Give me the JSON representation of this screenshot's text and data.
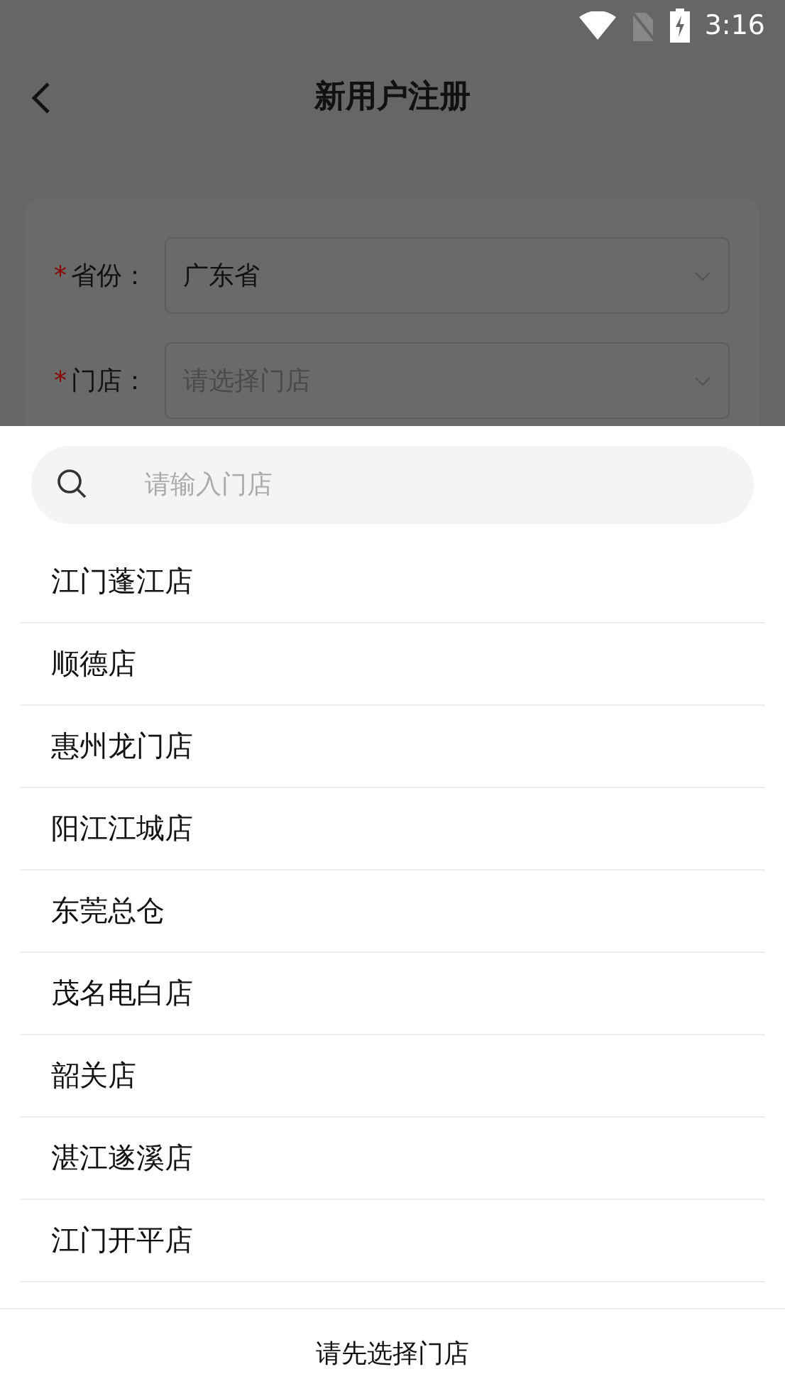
{
  "status_bar": {
    "time": "3:16"
  },
  "header": {
    "title": "新用户注册"
  },
  "form": {
    "fields": [
      {
        "mark": "*",
        "label": "省份：",
        "value": "广东省"
      },
      {
        "mark": "*",
        "label": "门店：",
        "placeholder": "请选择门店"
      }
    ]
  },
  "store_picker": {
    "search": {
      "placeholder": "请输入门店"
    },
    "stores": [
      "江门蓬江店",
      "顺德店",
      "惠州龙门店",
      "阳江江城店",
      "东莞总仓",
      "茂名电白店",
      "韶关店",
      "湛江遂溪店",
      "江门开平店"
    ],
    "footer": "请先选择门店"
  }
}
